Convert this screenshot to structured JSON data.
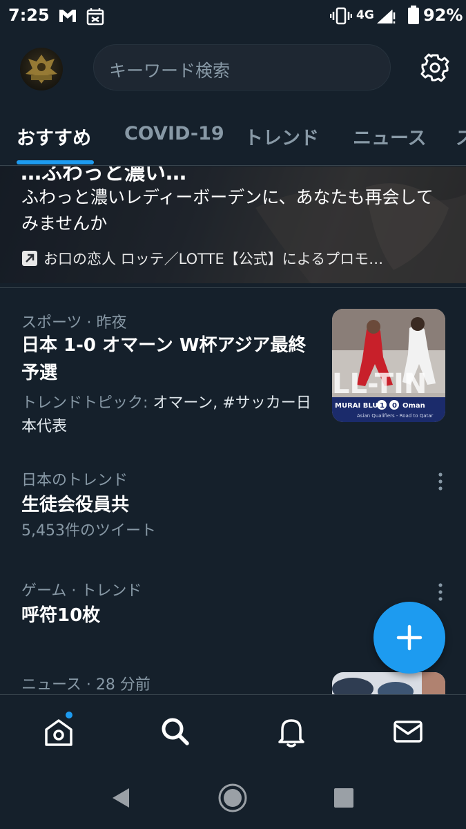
{
  "status_bar": {
    "time": "7:25",
    "network": "4G",
    "battery_percent": "92%",
    "icons": [
      "gmail-icon",
      "app-notification-icon",
      "vibrate-icon",
      "signal-icon",
      "battery-icon"
    ]
  },
  "header": {
    "search_placeholder": "キーワード検索",
    "settings_icon": "gear-icon",
    "avatar_icon": "avatar"
  },
  "tabs": [
    {
      "label": "おすすめ",
      "active": true
    },
    {
      "label": "COVID-19",
      "active": false
    },
    {
      "label": "トレンド",
      "active": false
    },
    {
      "label": "ニュース",
      "active": false
    }
  ],
  "promo": {
    "headline_partial": "…ふわっと濃い…",
    "text": "ふわっと濃いレディーボーデンに、あなたも再会してみませんか",
    "attribution": "お口の恋人 ロッテ／LOTTE【公式】によるプロモ…"
  },
  "story": {
    "category": "スポーツ",
    "time": "昨夜",
    "title": "日本 1-0 オマーン W杯アジア最終予選",
    "topics_label": "トレンドトピック: ",
    "topics": "オマーン, #サッカー日本代表",
    "image_caption": "MURAI BLUE 1 0 Oman",
    "image_subcaption": "Asian Qualifiers - Road to Qatar"
  },
  "trends": [
    {
      "context": "日本のトレンド",
      "title": "生徒会役員共",
      "count": "5,453件のツイート"
    },
    {
      "context": "ゲーム · トレンド",
      "title": "呼符10枚",
      "count": ""
    }
  ],
  "news": {
    "category": "ニュース",
    "time": "28 分前"
  },
  "colors": {
    "background": "#15202b",
    "accent": "#1d9bf0",
    "secondary_text": "#8899a6",
    "divider": "#38444d"
  },
  "bottom_nav": [
    "home-icon",
    "search-icon",
    "notifications-icon",
    "messages-icon"
  ],
  "system_nav": [
    "back-icon",
    "home-circle-icon",
    "recents-icon"
  ]
}
